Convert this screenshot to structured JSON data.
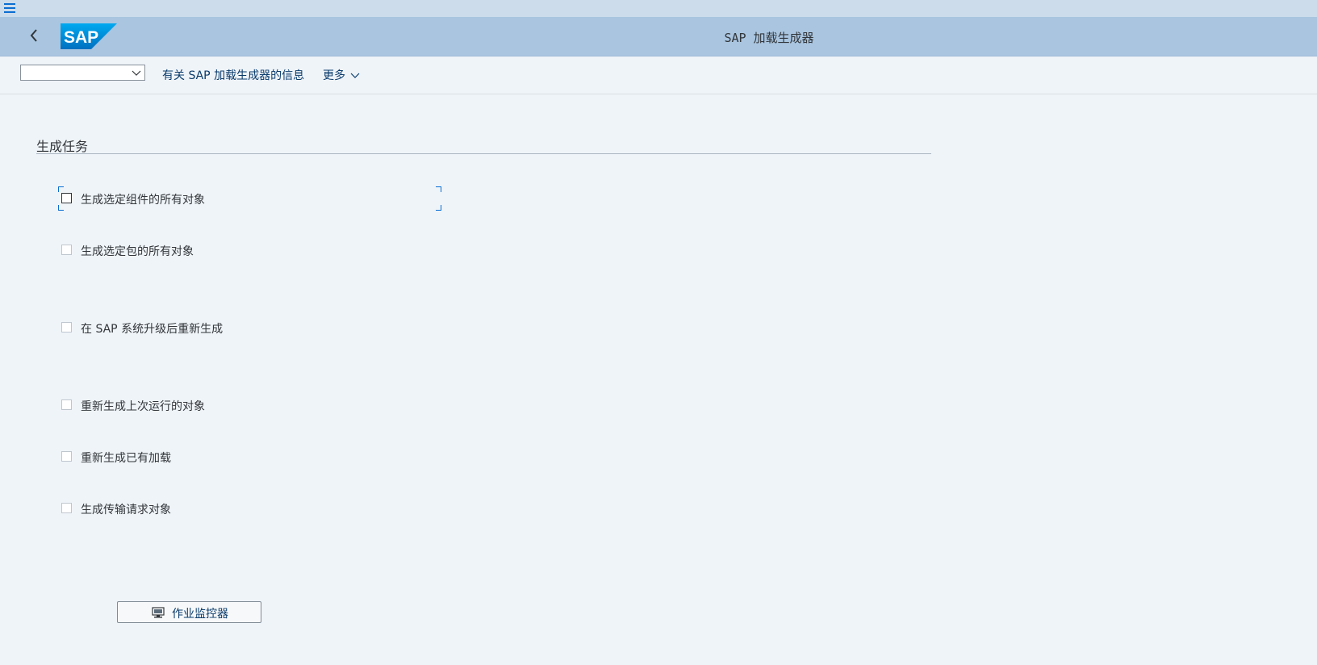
{
  "shell": {
    "title": "SAP 加载生成器",
    "logo_text": "SAP",
    "icons": {
      "menu": "hamburger-menu-icon",
      "back": "chevron-left-icon"
    }
  },
  "toolbar": {
    "select_value": "",
    "info_link": "有关 SAP 加载生成器的信息",
    "more_label": "更多"
  },
  "section": {
    "title": "生成任务"
  },
  "checkboxes": [
    {
      "label": "生成选定组件的所有对象",
      "checked": false
    },
    {
      "label": "生成选定包的所有对象",
      "checked": false
    },
    {
      "label": "在 SAP 系统升级后重新生成",
      "checked": false
    },
    {
      "label": "重新生成上次运行的对象",
      "checked": false
    },
    {
      "label": "重新生成已有加载",
      "checked": false
    },
    {
      "label": "生成传输请求对象",
      "checked": false
    }
  ],
  "job_button": {
    "label": "作业监控器",
    "icon": "monitor-icon"
  },
  "colors": {
    "accent": "#0a6ed1",
    "shellbar": "#a9c5e0",
    "background": "#eff4f9"
  }
}
